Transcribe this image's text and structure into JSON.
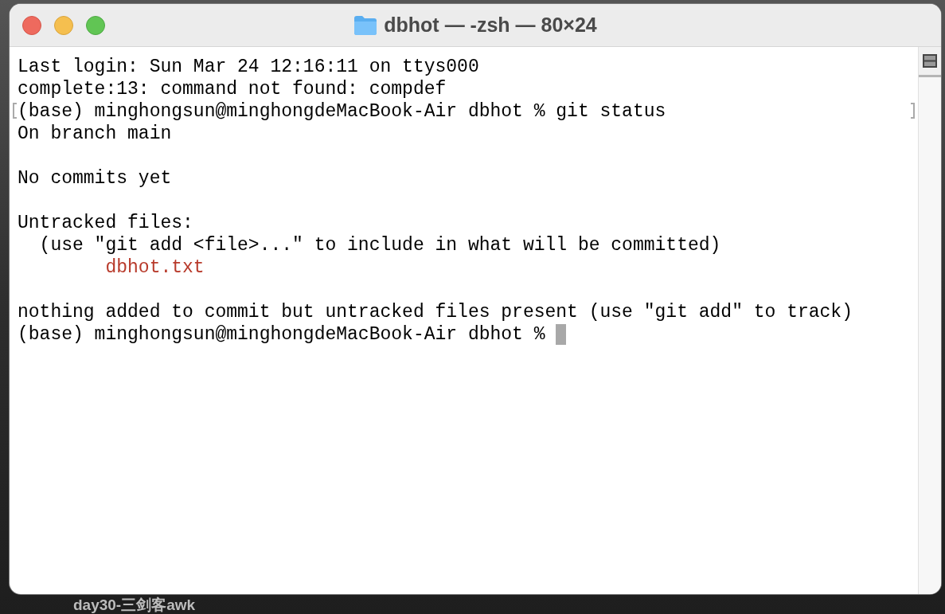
{
  "window": {
    "title": "dbhot — -zsh — 80×24"
  },
  "terminal": {
    "lines": [
      {
        "kind": "plain",
        "text": "Last login: Sun Mar 24 12:16:11 on ttys000",
        "marked": false,
        "cursor": false
      },
      {
        "kind": "plain",
        "text": "complete:13: command not found: compdef",
        "marked": false,
        "cursor": false
      },
      {
        "kind": "plain",
        "text": "(base) minghongsun@minghongdeMacBook-Air dbhot % git status",
        "marked": true,
        "cursor": false
      },
      {
        "kind": "plain",
        "text": "On branch main",
        "marked": false,
        "cursor": false
      },
      {
        "kind": "blank"
      },
      {
        "kind": "plain",
        "text": "No commits yet",
        "marked": false,
        "cursor": false
      },
      {
        "kind": "blank"
      },
      {
        "kind": "plain",
        "text": "Untracked files:",
        "marked": false,
        "cursor": false
      },
      {
        "kind": "plain",
        "text": "  (use \"git add <file>...\" to include in what will be committed)",
        "marked": false,
        "cursor": false
      },
      {
        "kind": "untracked",
        "text": "        dbhot.txt",
        "marked": false,
        "cursor": false
      },
      {
        "kind": "blank"
      },
      {
        "kind": "plain",
        "text": "nothing added to commit but untracked files present (use \"git add\" to track)",
        "marked": false,
        "cursor": false
      },
      {
        "kind": "plain",
        "text": "(base) minghongsun@minghongdeMacBook-Air dbhot % ",
        "marked": false,
        "cursor": true
      }
    ]
  },
  "desktop": {
    "label": "day30-三剑客awk"
  }
}
